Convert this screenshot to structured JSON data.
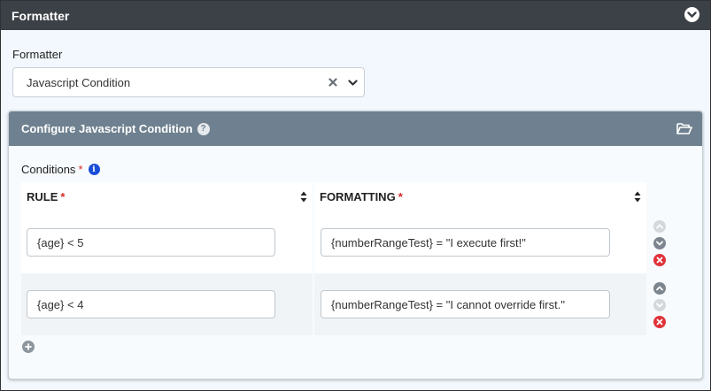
{
  "header": {
    "title": "Formatter"
  },
  "formatter": {
    "label": "Formatter",
    "selected": "Javascript Condition"
  },
  "panel": {
    "title": "Configure Javascript Condition"
  },
  "conditions": {
    "label": "Conditions",
    "required_mark": "*",
    "columns": [
      {
        "label": "RULE",
        "required_mark": "*"
      },
      {
        "label": "FORMATTING",
        "required_mark": "*"
      }
    ],
    "rows": [
      {
        "rule": "{age} < 5",
        "formatting": "{numberRangeTest} = \"I execute first!\"",
        "can_move_up": false,
        "can_move_down": true
      },
      {
        "rule": "{age} < 4",
        "formatting": "{numberRangeTest} = \"I cannot override first.\"",
        "can_move_up": true,
        "can_move_down": false
      }
    ]
  },
  "colors": {
    "topbar": "#3c4148",
    "panel_header": "#6f8190",
    "required": "#d62a2a",
    "info": "#1a4ed8",
    "remove": "#e0323a"
  }
}
